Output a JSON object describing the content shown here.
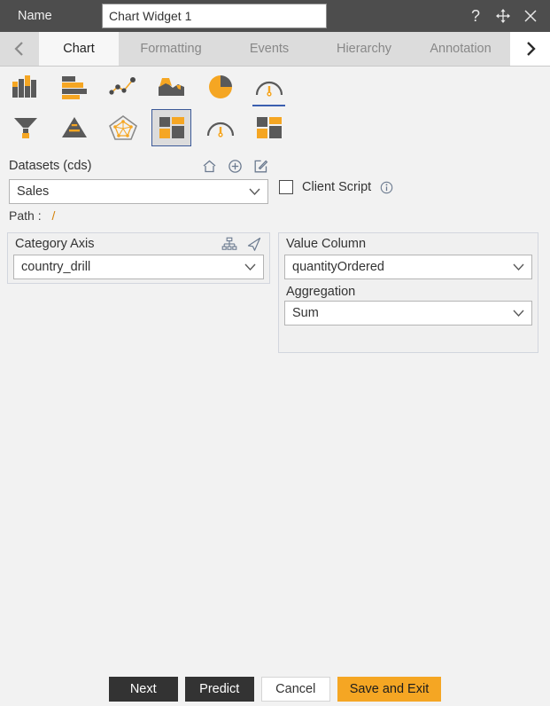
{
  "titlebar": {
    "name_label": "Name",
    "name_value": "Chart Widget 1",
    "name_placeholder": "Chart Widget 1",
    "help_icon": "question-mark-icon",
    "move_icon": "move-icon",
    "close_icon": "close-icon"
  },
  "tabs": {
    "prev_icon": "chevron-left-icon",
    "next_icon": "chevron-right-icon",
    "items": [
      {
        "label": "Chart",
        "active": true
      },
      {
        "label": "Formatting",
        "active": false
      },
      {
        "label": "Events",
        "active": false
      },
      {
        "label": "Hierarchy",
        "active": false
      },
      {
        "label": "Annotation",
        "active": false
      }
    ]
  },
  "chart_types": {
    "row1": [
      {
        "name": "column-chart-icon",
        "selected": false,
        "underline": false
      },
      {
        "name": "bar-chart-icon",
        "selected": false,
        "underline": false
      },
      {
        "name": "scatter-chart-icon",
        "selected": false,
        "underline": false
      },
      {
        "name": "area-chart-icon",
        "selected": false,
        "underline": false
      },
      {
        "name": "pie-chart-icon",
        "selected": false,
        "underline": false
      },
      {
        "name": "gauge-chart-icon",
        "selected": false,
        "underline": true
      }
    ],
    "row2": [
      {
        "name": "funnel-chart-icon",
        "selected": false,
        "underline": false
      },
      {
        "name": "pyramid-chart-icon",
        "selected": false,
        "underline": false
      },
      {
        "name": "radar-chart-icon",
        "selected": false,
        "underline": false
      },
      {
        "name": "treemap-chart-icon",
        "selected": true,
        "underline": false
      },
      {
        "name": "speedometer-chart-icon",
        "selected": false,
        "underline": false
      },
      {
        "name": "tile-chart-icon",
        "selected": false,
        "underline": false
      }
    ]
  },
  "datasets": {
    "label": "Datasets (cds)",
    "home_icon": "home-icon",
    "add_icon": "plus-circle-icon",
    "edit_icon": "edit-icon",
    "value": "Sales",
    "path_label": "Path :",
    "path_value": "/"
  },
  "client_script": {
    "label": "Client Script",
    "checked": false,
    "info_icon": "info-icon"
  },
  "category_axis": {
    "label": "Category Axis",
    "hierarchy_icon": "hierarchy-icon",
    "drill_icon": "paper-plane-icon",
    "value": "country_drill"
  },
  "value_column": {
    "label": "Value Column",
    "value": "quantityOrdered"
  },
  "aggregation": {
    "label": "Aggregation",
    "value": "Sum"
  },
  "footer": {
    "next_label": "Next",
    "predict_label": "Predict",
    "cancel_label": "Cancel",
    "save_label": "Save and Exit"
  },
  "colors": {
    "accent_orange": "#f5a623",
    "dark_gray": "#4d4d4d",
    "button_dark": "#333333",
    "selected_border": "#3b5998",
    "underline_blue": "#3b5fb0"
  }
}
